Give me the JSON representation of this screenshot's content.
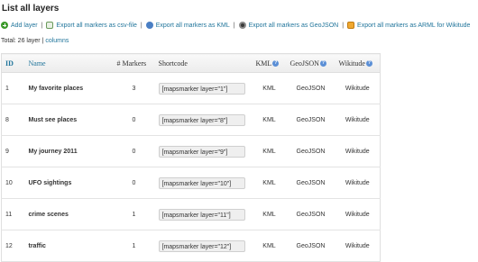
{
  "page": {
    "title": "List all layers"
  },
  "toolbar": {
    "add_layer": "Add layer",
    "export_csv": "Export all markers as csv-file",
    "export_kml": "Export all markers as KML",
    "export_geojson": "Export all markers as GeoJSON",
    "export_arml": "Export all markers as ARML for Wikitude",
    "separator": "|"
  },
  "summary": {
    "total": "Total: 26 layer",
    "separator": "|",
    "columns_link": "columns"
  },
  "table": {
    "headers": {
      "id": "ID",
      "name": "Name",
      "markers": "# Markers",
      "shortcode": "Shortcode",
      "kml": "KML",
      "geojson": "GeoJSON",
      "wikitude": "Wikitude",
      "help_glyph": "?"
    },
    "rows": [
      {
        "id": "1",
        "name": "My favorite places",
        "markers": "3",
        "shortcode": "[mapsmarker layer=\"1\"]",
        "kml": "KML",
        "geojson": "GeoJSON",
        "wikitude": "Wikitude"
      },
      {
        "id": "8",
        "name": "Must see places",
        "markers": "0",
        "shortcode": "[mapsmarker layer=\"8\"]",
        "kml": "KML",
        "geojson": "GeoJSON",
        "wikitude": "Wikitude"
      },
      {
        "id": "9",
        "name": "My journey 2011",
        "markers": "0",
        "shortcode": "[mapsmarker layer=\"9\"]",
        "kml": "KML",
        "geojson": "GeoJSON",
        "wikitude": "Wikitude"
      },
      {
        "id": "10",
        "name": "UFO sightings",
        "markers": "0",
        "shortcode": "[mapsmarker layer=\"10\"]",
        "kml": "KML",
        "geojson": "GeoJSON",
        "wikitude": "Wikitude"
      },
      {
        "id": "11",
        "name": "crime scenes",
        "markers": "1",
        "shortcode": "[mapsmarker layer=\"11\"]",
        "kml": "KML",
        "geojson": "GeoJSON",
        "wikitude": "Wikitude"
      },
      {
        "id": "12",
        "name": "traffic",
        "markers": "1",
        "shortcode": "[mapsmarker layer=\"12\"]",
        "kml": "KML",
        "geojson": "GeoJSON",
        "wikitude": "Wikitude"
      }
    ]
  },
  "icons": {
    "add": "add-icon",
    "csv": "spreadsheet-icon",
    "kml": "globe-icon",
    "geojson": "geojson-icon",
    "arml": "wikitude-icon",
    "help": "help-icon"
  },
  "colors": {
    "link": "#21759b",
    "header_bg": "#ececec",
    "add_icon": "#3c9a2b",
    "help_icon": "#5b8fd6"
  }
}
